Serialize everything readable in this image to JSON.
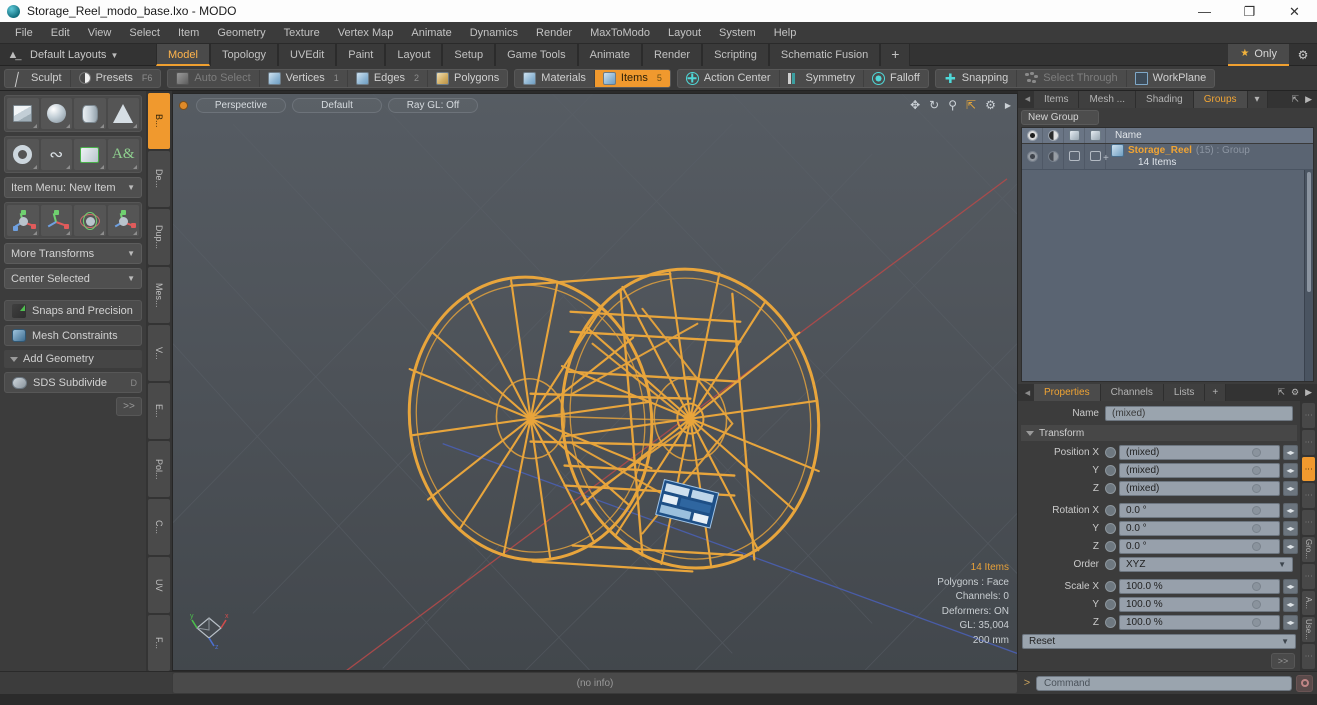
{
  "titlebar": {
    "title": "Storage_Reel_modo_base.lxo - MODO",
    "minimize": "—",
    "maximize": "❐",
    "close": "✕"
  },
  "menubar": {
    "items": [
      "File",
      "Edit",
      "View",
      "Select",
      "Item",
      "Geometry",
      "Texture",
      "Vertex Map",
      "Animate",
      "Dynamics",
      "Render",
      "MaxToModo",
      "Layout",
      "System",
      "Help"
    ]
  },
  "layoutbar": {
    "home_icon": "home-icon",
    "layout_name": "Default Layouts",
    "tabs": [
      {
        "label": "Model",
        "active": true
      },
      {
        "label": "Topology",
        "active": false
      },
      {
        "label": "UVEdit",
        "active": false
      },
      {
        "label": "Paint",
        "active": false
      },
      {
        "label": "Layout",
        "active": false
      },
      {
        "label": "Setup",
        "active": false
      },
      {
        "label": "Game Tools",
        "active": false
      },
      {
        "label": "Animate",
        "active": false
      },
      {
        "label": "Render",
        "active": false
      },
      {
        "label": "Scripting",
        "active": false
      },
      {
        "label": "Schematic Fusion",
        "active": false
      }
    ],
    "add_tab": "+",
    "only_label": "Only",
    "gear_icon": "gear-icon"
  },
  "toolbar": {
    "group_left": [
      {
        "label": "Sculpt",
        "icon": "sculpt-icon",
        "state": "normal",
        "num": ""
      },
      {
        "label": "Presets",
        "icon": "presets-icon",
        "state": "normal",
        "num": "F6"
      }
    ],
    "group_select": [
      {
        "label": "Auto Select",
        "icon": "cube-icon",
        "state": "dim",
        "num": ""
      },
      {
        "label": "Vertices",
        "icon": "cube-blue-icon",
        "state": "normal",
        "num": "1"
      },
      {
        "label": "Edges",
        "icon": "cube-blue-icon",
        "state": "normal",
        "num": "2"
      },
      {
        "label": "Polygons",
        "icon": "cube-gold-icon",
        "state": "normal",
        "num": ""
      }
    ],
    "group_items": [
      {
        "label": "Materials",
        "icon": "cube-blue-icon",
        "state": "normal",
        "num": ""
      },
      {
        "label": "Items",
        "icon": "cube-blue-icon",
        "state": "active",
        "num": "5"
      }
    ],
    "group_center": [
      {
        "label": "Action Center",
        "icon": "action-center-icon",
        "state": "normal",
        "num": ""
      },
      {
        "label": "Symmetry",
        "icon": "symmetry-icon",
        "state": "normal",
        "num": ""
      },
      {
        "label": "Falloff",
        "icon": "falloff-icon",
        "state": "normal",
        "num": ""
      }
    ],
    "group_snap": [
      {
        "label": "Snapping",
        "icon": "snapping-icon",
        "state": "normal",
        "num": ""
      },
      {
        "label": "Select Through",
        "icon": "select-through-icon",
        "state": "dim",
        "num": ""
      },
      {
        "label": "WorkPlane",
        "icon": "workplane-icon",
        "state": "normal",
        "num": ""
      }
    ]
  },
  "leftpanel": {
    "primitives_row1": [
      {
        "name": "cube-primitive",
        "shape": "cube"
      },
      {
        "name": "sphere-primitive",
        "shape": "sphere"
      },
      {
        "name": "cylinder-primitive",
        "shape": "cylinder"
      },
      {
        "name": "cone-primitive",
        "shape": "cone"
      }
    ],
    "primitives_row2": [
      {
        "name": "torus-primitive",
        "shape": "torus"
      },
      {
        "name": "curve-primitive",
        "shape": "curve"
      },
      {
        "name": "bezier-primitive",
        "shape": "green"
      },
      {
        "name": "text-primitive",
        "shape": "text"
      }
    ],
    "item_menu": "Item Menu: New Item",
    "transforms": [
      {
        "name": "move-tool"
      },
      {
        "name": "scale-tool"
      },
      {
        "name": "rotate-tool"
      },
      {
        "name": "transform-tool"
      }
    ],
    "more_transforms": "More Transforms",
    "center_selected": "Center Selected",
    "snaps_and_precision": "Snaps and Precision",
    "mesh_constraints": "Mesh Constraints",
    "add_geometry": "Add Geometry",
    "sds_subdivide": "SDS Subdivide",
    "sds_key": "D",
    "more_button": ">>",
    "vtabs": [
      {
        "label": "B...",
        "active": true
      },
      {
        "label": "De...",
        "active": false
      },
      {
        "label": "Dup...",
        "active": false
      },
      {
        "label": "Mes...",
        "active": false
      },
      {
        "label": "V...",
        "active": false
      },
      {
        "label": "E...",
        "active": false
      },
      {
        "label": "Pol...",
        "active": false
      },
      {
        "label": "C...",
        "active": false
      },
      {
        "label": "UV",
        "active": false
      },
      {
        "label": "F...",
        "active": false
      }
    ]
  },
  "viewport": {
    "pills": [
      "Perspective",
      "Default",
      "Ray GL: Off"
    ],
    "icons": [
      "pan-icon",
      "rotate-icon",
      "zoom-icon",
      "fit-icon",
      "gear-icon",
      "chevron-right-icon"
    ],
    "stats": [
      "14 Items",
      "Polygons : Face",
      "Channels: 0",
      "Deformers: ON",
      "GL: 35,004",
      "200 mm"
    ],
    "axis_gizmo": "axis-gizmo",
    "model_name": "storage-reel-wireframe"
  },
  "rightpanel": {
    "top_tabs": [
      {
        "label": "Items",
        "active": false
      },
      {
        "label": "Mesh ...",
        "active": false
      },
      {
        "label": "Shading",
        "active": false
      },
      {
        "label": "Groups",
        "active": true
      }
    ],
    "top_tab_caret": "▾",
    "groups": {
      "new_group_button": "New Group",
      "columns": [
        "Name"
      ],
      "column_icons": [
        "eye-icon",
        "render-icon",
        "shade-icon",
        "wire-icon"
      ],
      "rows": [
        {
          "name": "Storage_Reel",
          "meta": "(15) : Group",
          "sub": "14 Items",
          "expander": "+"
        }
      ]
    },
    "props_tabs": [
      {
        "label": "Properties",
        "active": true
      },
      {
        "label": "Channels",
        "active": false
      },
      {
        "label": "Lists",
        "active": false
      },
      {
        "label": "+",
        "active": false
      }
    ],
    "properties": {
      "name_label": "Name",
      "name_value": "(mixed)",
      "transform_section": "Transform",
      "rows": [
        {
          "label": "Position X",
          "value": "(mixed)"
        },
        {
          "label": "Y",
          "value": "(mixed)"
        },
        {
          "label": "Z",
          "value": "(mixed)"
        },
        {
          "label": "Rotation X",
          "value": "0.0 °"
        },
        {
          "label": "Y",
          "value": "0.0 °"
        },
        {
          "label": "Z",
          "value": "0.0 °"
        }
      ],
      "order_label": "Order",
      "order_value": "XYZ",
      "scale_rows": [
        {
          "label": "Scale X",
          "value": "100.0 %"
        },
        {
          "label": "Y",
          "value": "100.0 %"
        },
        {
          "label": "Z",
          "value": "100.0 %"
        }
      ],
      "reset_value": "Reset",
      "more_button": ">>"
    },
    "vtabs": [
      {
        "label": "⋮",
        "active": false
      },
      {
        "label": "⋮",
        "active": false
      },
      {
        "label": "⋮",
        "active": true
      },
      {
        "label": "⋮",
        "active": false
      },
      {
        "label": "⋮",
        "active": false
      },
      {
        "label": "Gro...",
        "active": false
      },
      {
        "label": "⋮",
        "active": false
      },
      {
        "label": "A...",
        "active": false
      },
      {
        "label": "Use...",
        "active": false
      },
      {
        "label": "⋮",
        "active": false
      }
    ]
  },
  "bottombar": {
    "status": "(no info)",
    "command_prompt": ">",
    "command_placeholder": "Command",
    "record_icon": "record-icon"
  },
  "colors": {
    "accent_orange": "#f0992e",
    "wireframe_orange": "#e8a53c",
    "viewport_bg": "#4d5258",
    "panel_bg": "#3a3a3a"
  }
}
